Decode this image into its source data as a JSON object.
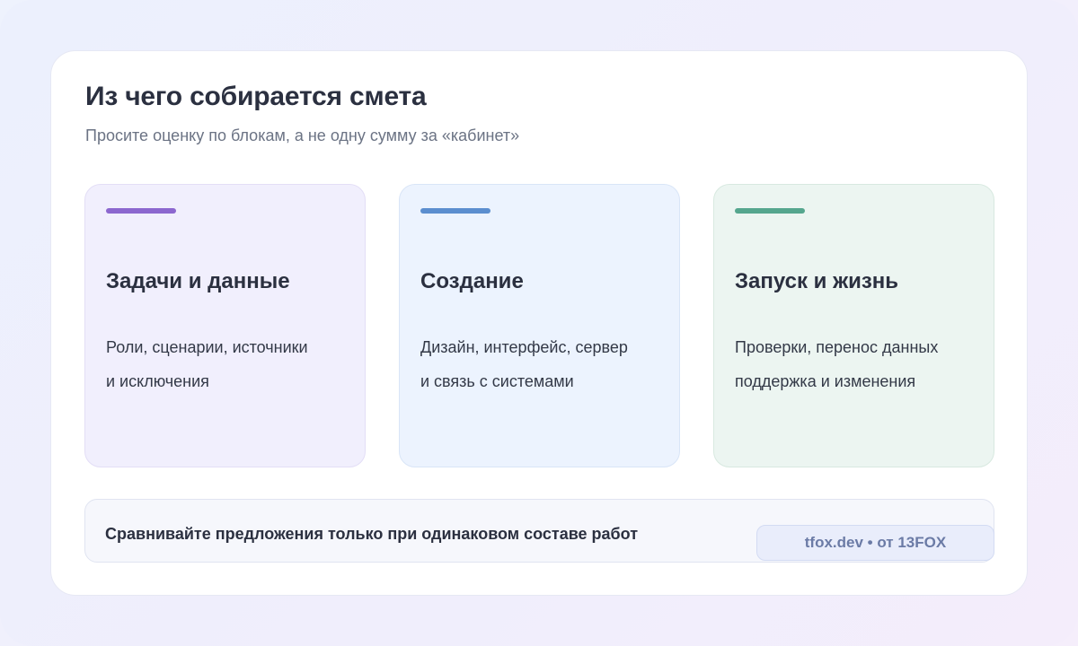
{
  "header": {
    "title": "Из чего собирается смета",
    "subtitle": "Просите оценку по блокам, а не одну сумму за «кабинет»"
  },
  "cards": [
    {
      "title": "Задачи и данные",
      "line1": "Роли, сценарии, источники",
      "line2": "и исключения",
      "accent": "#8c67cf"
    },
    {
      "title": "Создание",
      "line1": "Дизайн, интерфейс, сервер",
      "line2": "и связь с системами",
      "accent": "#5b8ecf"
    },
    {
      "title": "Запуск и жизнь",
      "line1": "Проверки, перенос данных",
      "line2": "поддержка и изменения",
      "accent": "#55a68e"
    }
  ],
  "footer": {
    "note": "Сравнивайте предложения только при одинаковом составе работ",
    "tag": "tfox.dev • от 13FOX"
  }
}
